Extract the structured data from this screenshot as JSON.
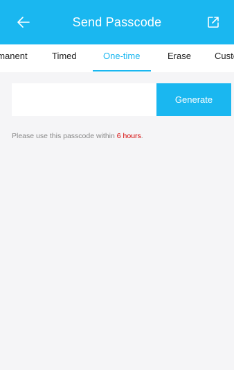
{
  "header": {
    "title": "Send Passcode",
    "back_icon": "arrow-left-icon",
    "share_icon": "external-link-icon"
  },
  "tabs": [
    {
      "label": "Permanent",
      "active": false
    },
    {
      "label": "Timed",
      "active": false
    },
    {
      "label": "One-time",
      "active": true
    },
    {
      "label": "Erase",
      "active": false
    },
    {
      "label": "Custom",
      "active": false
    }
  ],
  "passcode": {
    "value": "",
    "placeholder": "",
    "generate_label": "Generate"
  },
  "hint": {
    "prefix": "Please use this passcode within ",
    "highlight": "6 hours",
    "suffix": "."
  },
  "colors": {
    "accent": "#1ab7f0",
    "highlight": "#d40000",
    "background": "#f5f5f7"
  }
}
